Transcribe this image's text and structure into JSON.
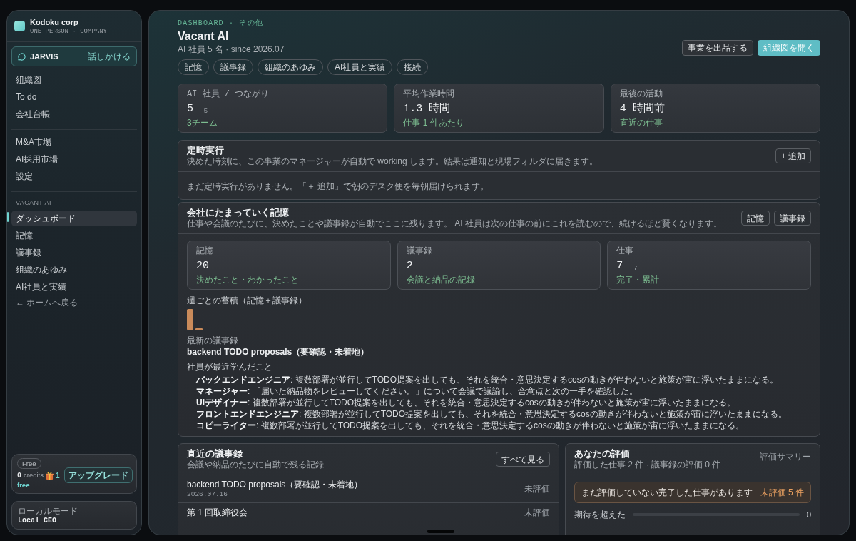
{
  "sidebar": {
    "brand": {
      "name": "Kodoku corp",
      "tagline": "ONE-PERSON · COMPANY"
    },
    "assistant": {
      "name": "JARVIS",
      "action": "話しかける"
    },
    "nav_sections": [
      {
        "items": [
          {
            "label": "組織図",
            "selected": false
          },
          {
            "label": "To do",
            "selected": false
          },
          {
            "label": "会社台帳",
            "selected": false
          }
        ]
      },
      {
        "items": [
          {
            "label": "M&A市場",
            "selected": false
          },
          {
            "label": "AI採用市場",
            "selected": false
          },
          {
            "label": "設定",
            "selected": false
          }
        ]
      },
      {
        "title": "VACANT AI",
        "items": [
          {
            "label": "ダッシュボード",
            "selected": true
          },
          {
            "label": "記憶",
            "selected": false
          },
          {
            "label": "議事録",
            "selected": false
          },
          {
            "label": "組織のあゆみ",
            "selected": false
          },
          {
            "label": "AI社員と実績",
            "selected": false
          }
        ],
        "back_link": "← ホームへ戻る"
      }
    ],
    "plan": {
      "badge": "Free",
      "credits": "0",
      "credits_label": "credits",
      "gifts": "1",
      "tier": "free",
      "upgrade_button": "アップグレード"
    },
    "mode": {
      "label": "ローカルモード",
      "value": "Local CEO"
    }
  },
  "header": {
    "breadcrumb": "DASHBOARD · その他",
    "title": "Vacant AI",
    "subtitle": "AI 社員 5 名 · since 2026.07",
    "tags": [
      "記憶",
      "議事録",
      "組織のあゆみ",
      "AI社員と実績",
      "接続"
    ],
    "actions": [
      {
        "label": "事業を出品する",
        "kind": "secondary"
      },
      {
        "label": "組織図を開く",
        "kind": "primary"
      }
    ]
  },
  "stats": [
    {
      "label": "AI 社員 / つながり",
      "value": "5",
      "extra": "· 5",
      "note": "3チーム"
    },
    {
      "label": "平均作業時間",
      "value": "1.3 時間",
      "note": "仕事 1 件あたり"
    },
    {
      "label": "最後の活動",
      "value": "4 時間前",
      "note": "直近の仕事"
    }
  ],
  "schedule": {
    "title": "定時実行",
    "description": "決めた時刻に、この事業のマネージャーが自動で working します。結果は通知と現場フォルダに届きます。",
    "add_button": "+ 追加",
    "empty": "まだ定時実行がありません。「＋ 追加」で朝のデスク便を毎朝届けられます。"
  },
  "memory": {
    "title": "会社にたまっていく記憶",
    "description": "仕事や会議のたびに、決めたことや議事録が自動でここに残ります。 AI 社員は次の仕事の前にこれを読むので、続けるほど賢くなります。",
    "buttons": [
      "記憶",
      "議事録"
    ],
    "stats": [
      {
        "label": "記憶",
        "value": "20",
        "note": "決めたこと・わかったこと"
      },
      {
        "label": "議事録",
        "value": "2",
        "note": "会議と納品の記録"
      },
      {
        "label": "仕事",
        "value": "7",
        "extra": "· 7",
        "note": "完了・累計"
      }
    ],
    "weekly_title": "週ごとの蓄積（記憶＋議事録）",
    "latest_label": "最新の議事録",
    "latest_title": "backend TODO proposals（要確認・未着地）",
    "learned_label": "社員が最近学んだこと",
    "learned": [
      "**バックエンドエンジニア**: 複数部署が並行してTODO提案を出しても、それを統合・意思決定するcosの動きが伴わないと施策が宙に浮いたままになる。",
      "**マネージャー**: 「届いた納品物をレビューしてください。」について会議で議論し、合意点と次の一手を確認した。",
      "**UIデザイナー**: 複数部署が並行してTODO提案を出しても、それを統合・意思決定するcosの動きが伴わないと施策が宙に浮いたままになる。",
      "**フロントエンドエンジニア**: 複数部署が並行してTODO提案を出しても、それを統合・意思決定するcosの動きが伴わないと施策が宙に浮いたままになる。",
      "**コピーライター**: 複数部署が並行してTODO提案を出しても、それを統合・意思決定するcosの動きが伴わないと施策が宙に浮いたままになる。"
    ]
  },
  "minutes": {
    "title": "直近の議事録",
    "description": "会議や納品のたびに自動で残る記録",
    "button": "すべて見る",
    "rows": [
      {
        "title": "backend TODO proposals（要確認・未着地）",
        "date": "2026.07.16",
        "status": "未評価"
      },
      {
        "title": "第 1 回取締役会",
        "status": "未評価"
      }
    ]
  },
  "ratings": {
    "title": "あなたの評価",
    "link": "評価サマリー",
    "description": "評価した仕事 2 件 · 議事録の評価 0 件",
    "alert": {
      "message": "まだ評価していない完了した仕事があります",
      "count": "未評価 5 件"
    },
    "rows": [
      {
        "label": "期待を超えた",
        "count": "0"
      }
    ]
  }
}
